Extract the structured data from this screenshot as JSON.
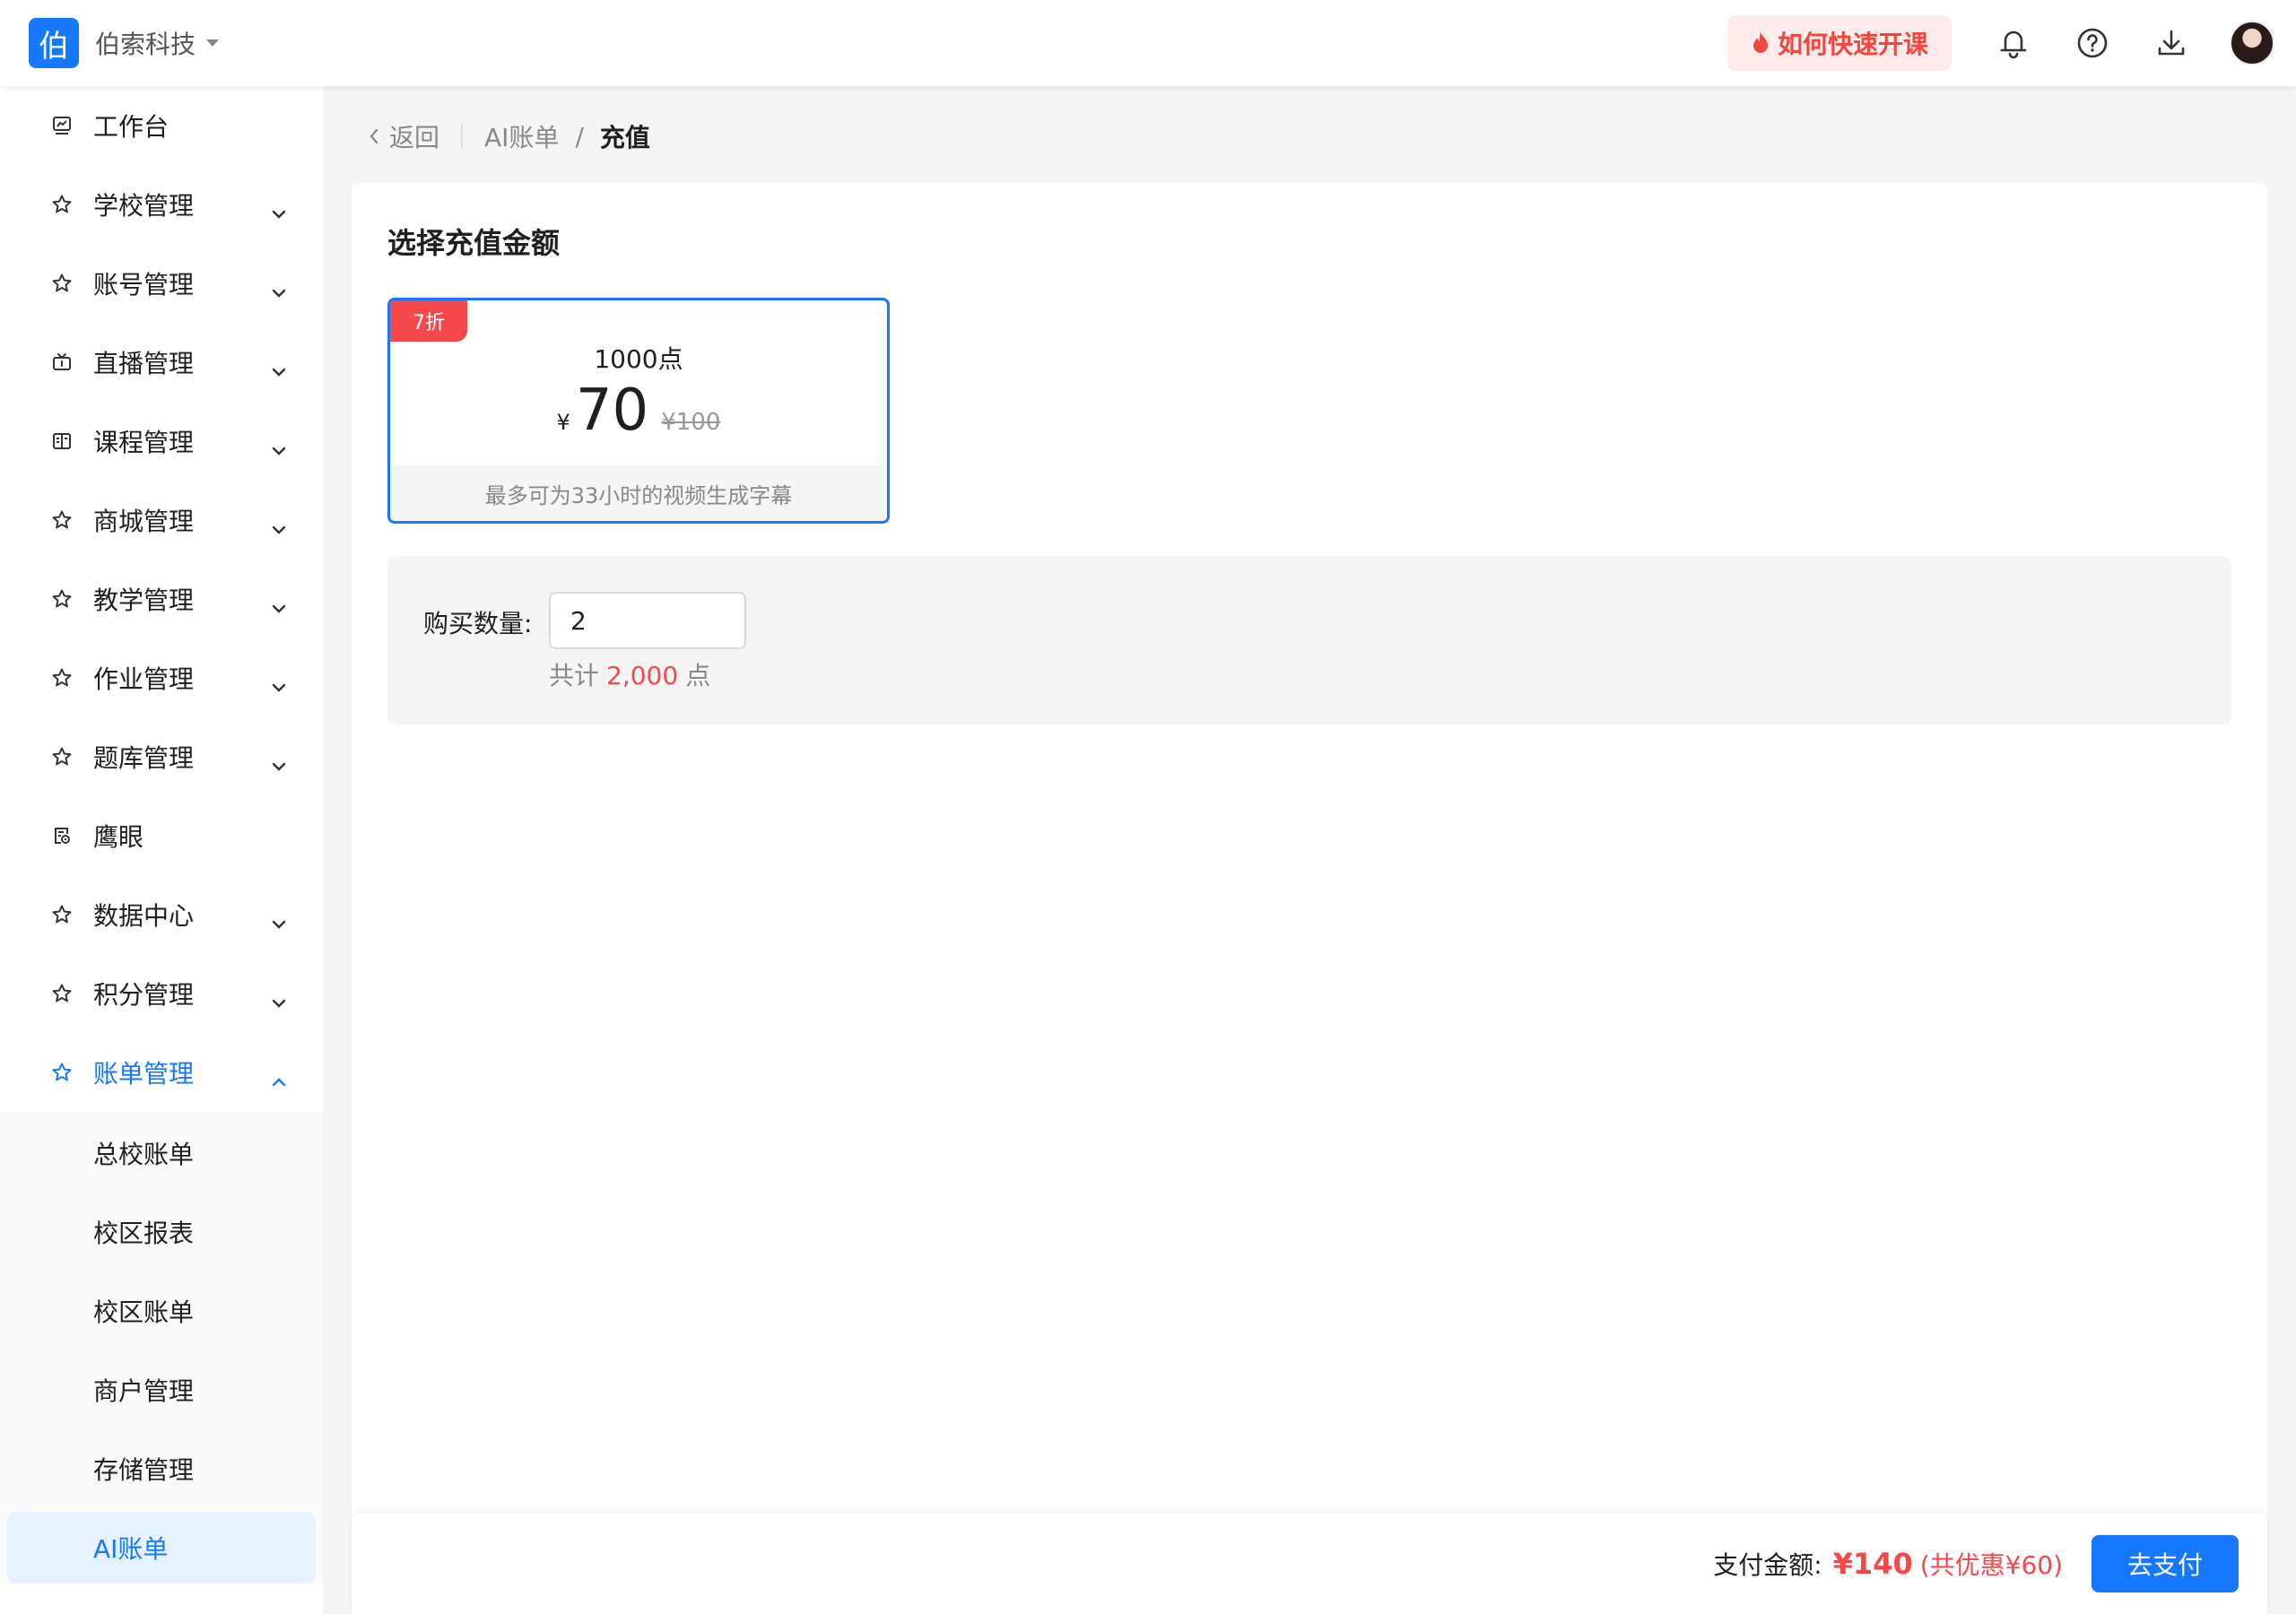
{
  "topbar": {
    "logo_char": "伯",
    "org_name": "伯索科技",
    "quick_start_label": "如何快速开课",
    "icons": [
      "bell-icon",
      "help-icon",
      "download-icon",
      "avatar"
    ]
  },
  "sidebar": {
    "items": [
      {
        "label": "工作台",
        "icon": "chart-icon",
        "expandable": false
      },
      {
        "label": "学校管理",
        "icon": "star-icon",
        "expandable": true
      },
      {
        "label": "账号管理",
        "icon": "star-icon",
        "expandable": true
      },
      {
        "label": "直播管理",
        "icon": "tv-icon",
        "expandable": true
      },
      {
        "label": "课程管理",
        "icon": "book-icon",
        "expandable": true
      },
      {
        "label": "商城管理",
        "icon": "star-icon",
        "expandable": true
      },
      {
        "label": "教学管理",
        "icon": "star-icon",
        "expandable": true
      },
      {
        "label": "作业管理",
        "icon": "star-icon",
        "expandable": true
      },
      {
        "label": "题库管理",
        "icon": "star-icon",
        "expandable": true
      },
      {
        "label": "鹰眼",
        "icon": "eye-doc-icon",
        "expandable": false
      },
      {
        "label": "数据中心",
        "icon": "star-icon",
        "expandable": true
      },
      {
        "label": "积分管理",
        "icon": "star-icon",
        "expandable": true
      },
      {
        "label": "账单管理",
        "icon": "star-icon",
        "expandable": true,
        "expanded": true
      }
    ],
    "submenu": [
      {
        "label": "总校账单"
      },
      {
        "label": "校区报表"
      },
      {
        "label": "校区账单"
      },
      {
        "label": "商户管理"
      },
      {
        "label": "存储管理"
      },
      {
        "label": "AI账单",
        "selected": true
      }
    ]
  },
  "breadcrumb": {
    "back": "返回",
    "parent": "AI账单",
    "separator": "/",
    "current": "充值"
  },
  "recharge": {
    "section_title": "选择充值金额",
    "package": {
      "badge": "7折",
      "points": "1000点",
      "currency": "¥",
      "price": "70",
      "original_price": "¥100",
      "note": "最多可为33小时的视频生成字幕"
    },
    "quantity": {
      "label": "购买数量:",
      "value": "2",
      "total_prefix": "共计",
      "total_value": "2,000",
      "total_suffix": "点"
    }
  },
  "payment": {
    "label": "支付金额:",
    "amount": "¥140",
    "discount": "(共优惠¥60)",
    "button": "去支付"
  },
  "colors": {
    "primary": "#1677ff",
    "danger": "#f5484b",
    "quick_bg": "#fdeceb"
  }
}
